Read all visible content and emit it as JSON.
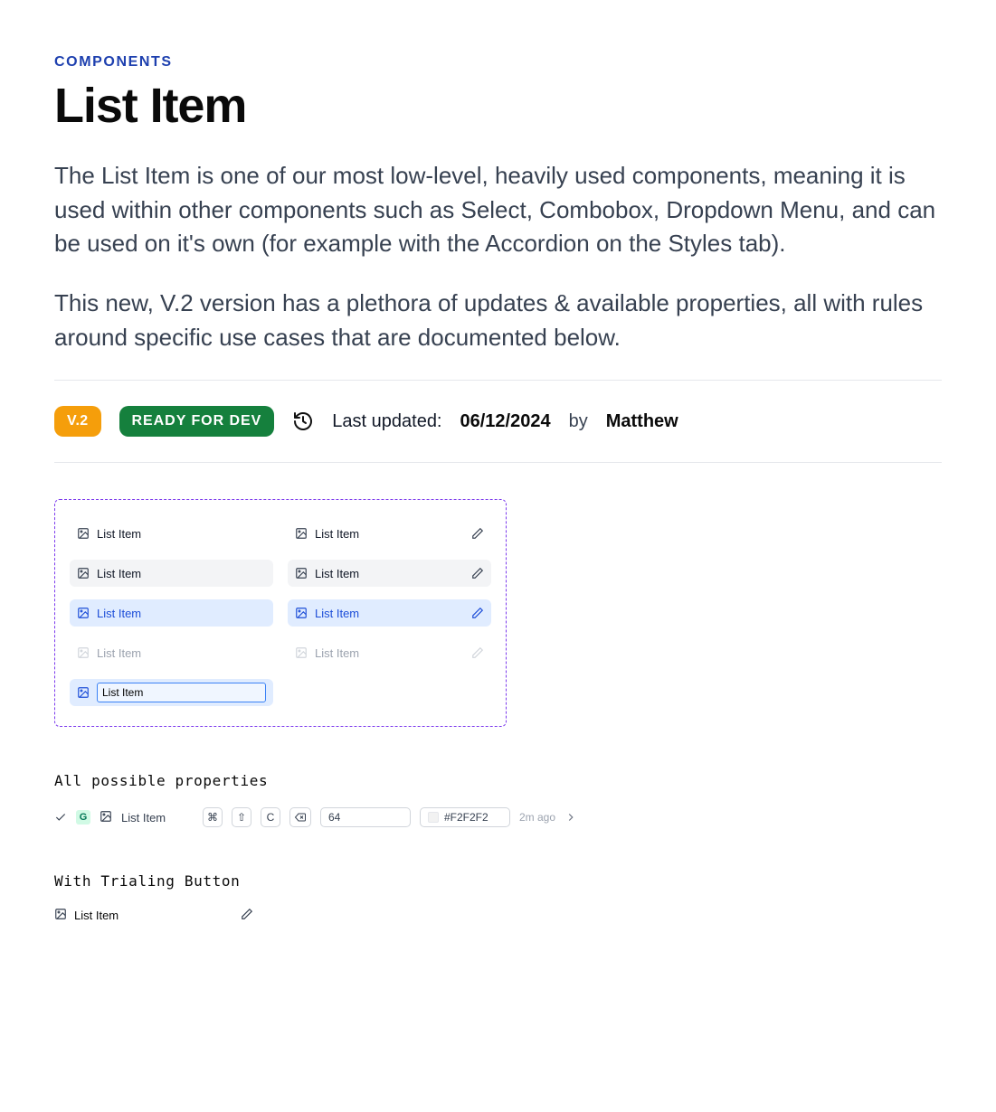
{
  "header": {
    "eyebrow": "COMPONENTS",
    "title": "List Item",
    "intro1": "The List Item is one of our most low-level, heavily used components, meaning it is used within other components such as Select, Combobox, Dropdown Menu, and can be used on it's own (for example with the Accordion on the Styles tab).",
    "intro2": "This new, V.2 version has a plethora of updates & available properties, all with rules around specific use cases that are documented below."
  },
  "meta": {
    "version": "V.2",
    "status": "READY FOR DEV",
    "label": "Last updated:",
    "date": "06/12/2024",
    "by": "by",
    "author": "Matthew"
  },
  "preview": {
    "left": {
      "default": "List Item",
      "hover": "List Item",
      "selected": "List Item",
      "disabled": "List Item",
      "editing": "List Item"
    },
    "right": {
      "default": "List Item",
      "hover": "List Item",
      "selected": "List Item",
      "disabled": "List Item"
    }
  },
  "sections": {
    "props_label": "All possible properties",
    "trailing_label": "With Trialing Button"
  },
  "props": {
    "badge": "G",
    "label": "List Item",
    "kbd_cmd": "⌘",
    "kbd_shift": "⇧",
    "kbd_key": "C",
    "value": "64",
    "color": "#F2F2F2",
    "timestamp": "2m ago"
  },
  "trailing": {
    "label": "List Item"
  }
}
